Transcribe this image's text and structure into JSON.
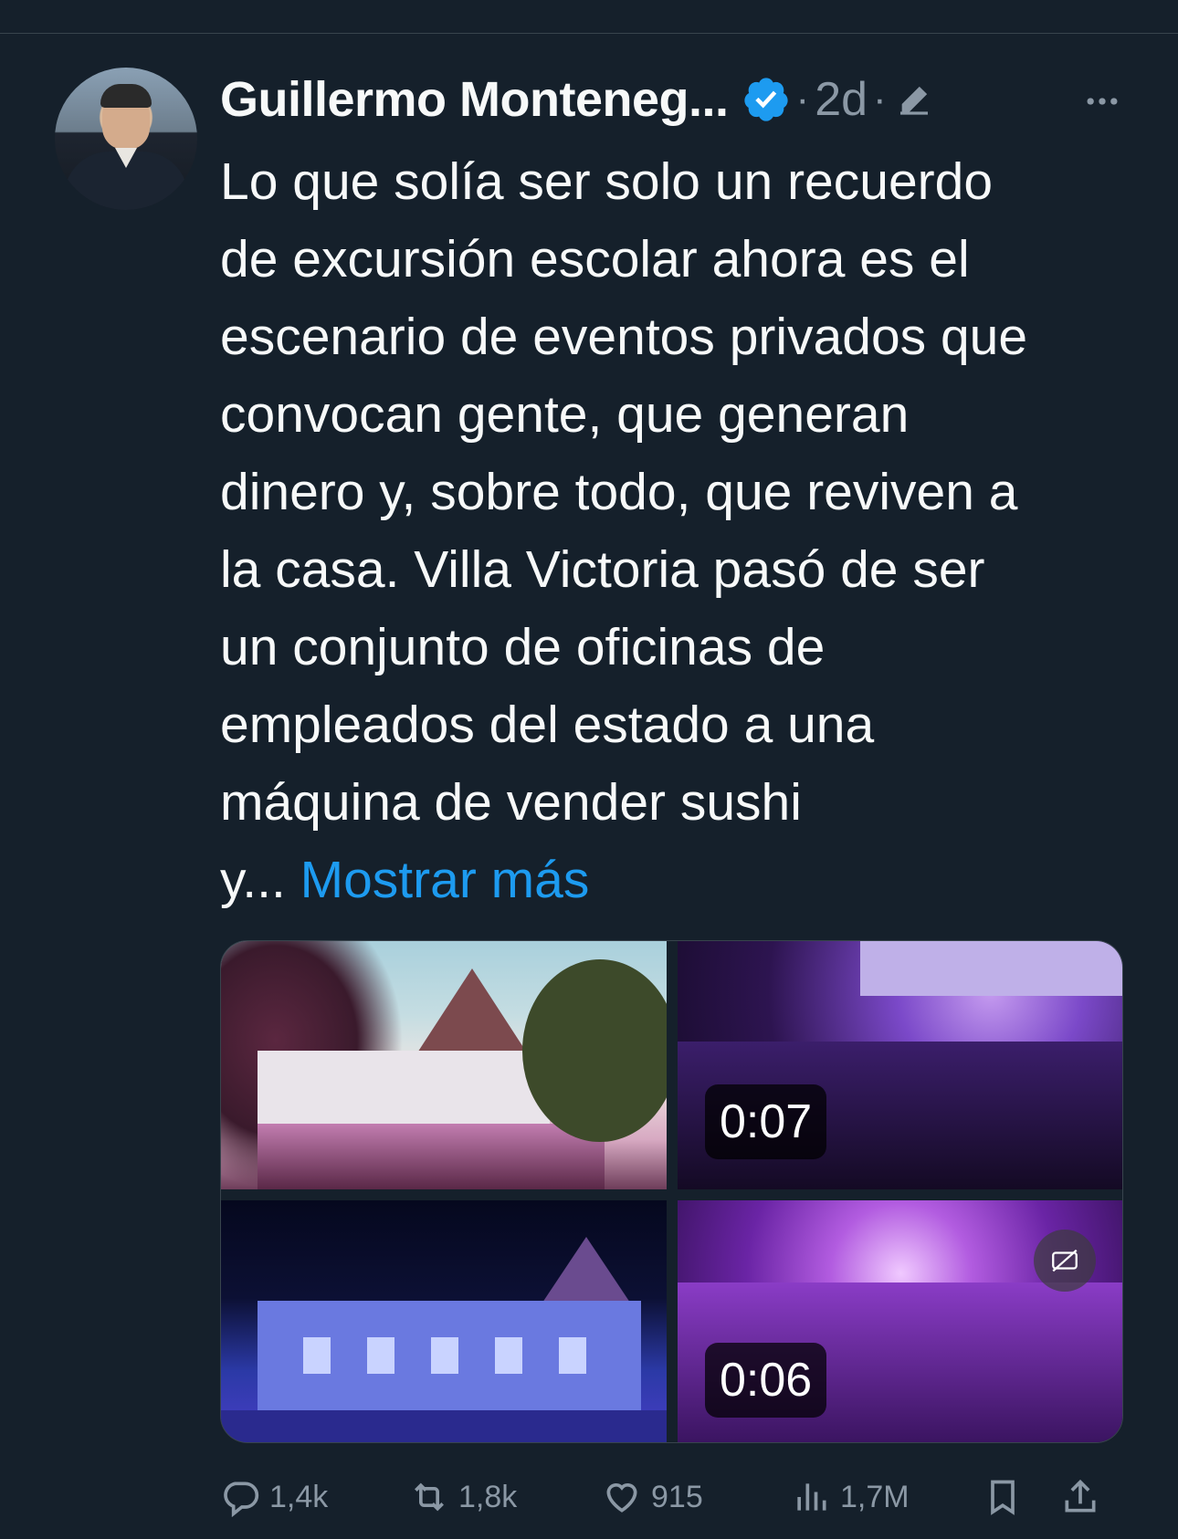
{
  "tweet": {
    "author_name": "Guillermo Monteneg...",
    "time_ago": "2d",
    "separator": "·",
    "text_lines": [
      "Lo que solía ser solo un recuerdo",
      "de excursión escolar ahora es el",
      "escenario de eventos privados que",
      "convocan gente, que generan",
      "dinero y, sobre todo, que reviven a",
      "la casa. Villa Victoria pasó de ser",
      "un conjunto de oficinas de",
      "empleados del estado a una",
      "máquina de vender sushi"
    ],
    "truncated_start": "y...",
    "show_more_label": "Mostrar más",
    "media": [
      {
        "kind": "photo",
        "name": "villa-victoria-sunset"
      },
      {
        "kind": "video",
        "duration": "0:07"
      },
      {
        "kind": "photo",
        "name": "villa-victoria-night"
      },
      {
        "kind": "video",
        "duration": "0:06"
      }
    ]
  },
  "actions": {
    "replies": "1,4k",
    "retweets": "1,8k",
    "likes": "915",
    "views": "1,7M"
  },
  "colors": {
    "background": "#15202b",
    "text": "#f7f9f9",
    "secondary": "#8b98a5",
    "link": "#1d9bf0",
    "verified": "#1d9bf0"
  },
  "icons": [
    "verified-badge-icon",
    "edit-icon",
    "more-icon",
    "captions-icon",
    "reply-icon",
    "retweet-icon",
    "like-icon",
    "views-icon",
    "bookmark-icon",
    "share-icon"
  ]
}
